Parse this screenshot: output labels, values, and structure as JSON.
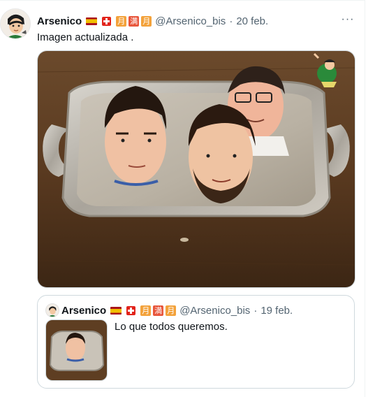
{
  "tweet": {
    "author_name": "Arsenico",
    "handle": "@Arsenico_bis",
    "date_sep": "·",
    "date": "20 feb.",
    "text": "Imagen actualizada .",
    "badges": [
      "月",
      "满",
      "月"
    ],
    "more_label": "···"
  },
  "quoted_tweet": {
    "author_name": "Arsenico",
    "handle": "@Arsenico_bis",
    "date_sep": "·",
    "date": "19 feb.",
    "text": "Lo que todos queremos.",
    "badges": [
      "月",
      "満",
      "月"
    ]
  },
  "colors": {
    "text_primary": "#0f1419",
    "text_secondary": "#536471",
    "border": "#cfd9de",
    "flag_red": "#aa151b",
    "flag_yellow": "#f1bf00",
    "swiss_red": "#e2231a",
    "badge_orange": "#f3a23b",
    "badge_red": "#e8563c"
  },
  "icons": [
    "avatar-cartoon-icon",
    "spain-flag-icon",
    "swiss-flag-icon",
    "more-options-icon",
    "lupin-sticker-icon"
  ]
}
